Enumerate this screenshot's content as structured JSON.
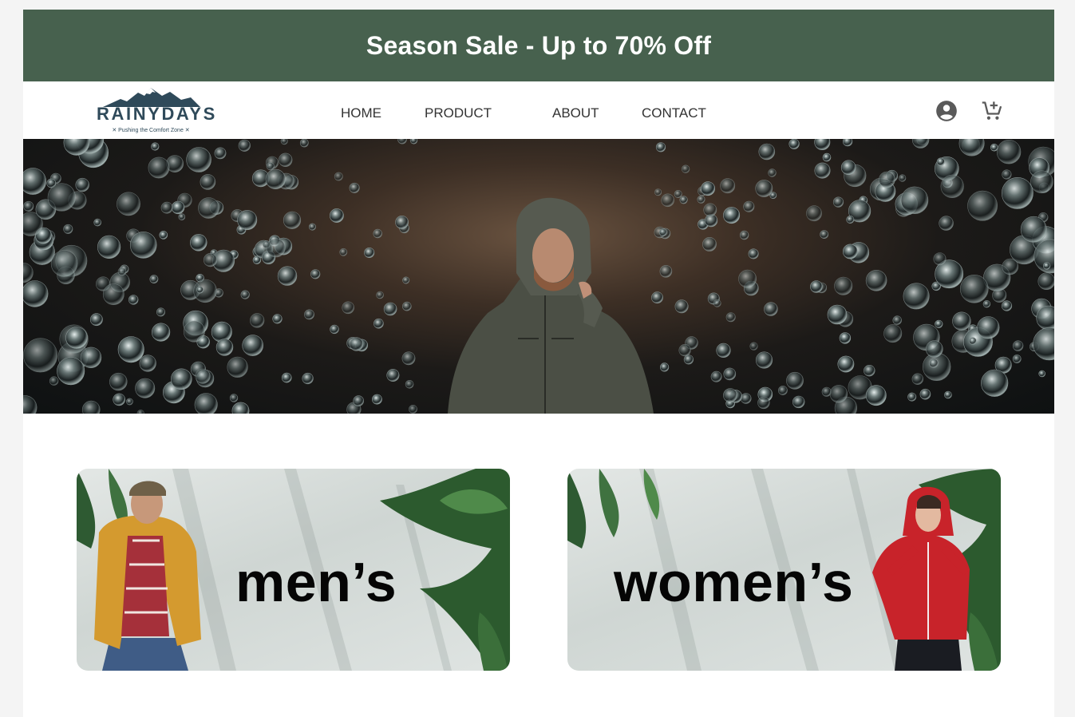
{
  "banner": {
    "text": "Season Sale - Up to 70% Off"
  },
  "brand": {
    "name": "RAINYDAYS",
    "tagline": "✕ Pushing the Comfort Zone ✕"
  },
  "nav": {
    "home": "HOME",
    "product": "PRODUCT",
    "about": "ABOUT",
    "contact": "CONTACT"
  },
  "icons": {
    "account": "account-circle-icon",
    "cart": "add-to-cart-icon"
  },
  "colors": {
    "banner": "#47614e",
    "logo": "#2f4a5a",
    "womens_jacket": "#c8232a",
    "mens_jacket": "#d49a2f"
  },
  "categories": {
    "mens": "men’s",
    "womens": "women’s"
  }
}
